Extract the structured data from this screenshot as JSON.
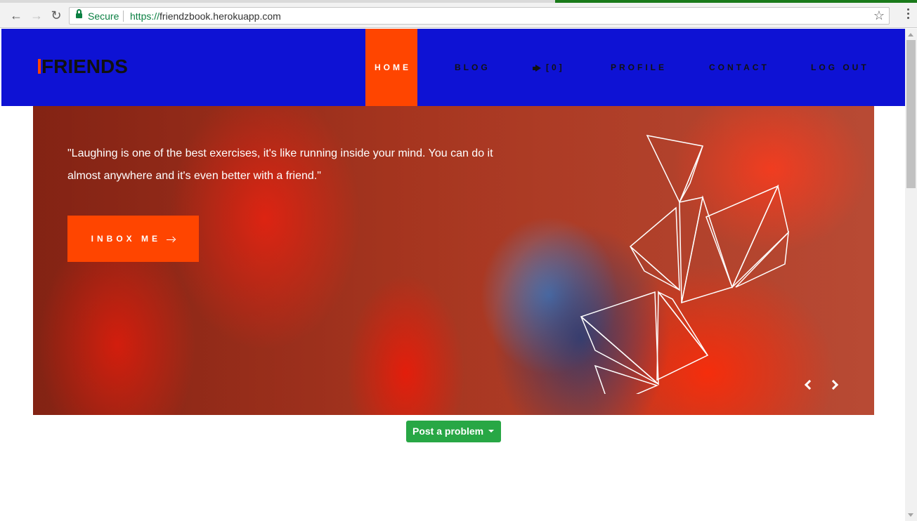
{
  "browser": {
    "security_label": "Secure",
    "url_scheme": "https://",
    "url_rest": "friendzbook.herokuapp.com"
  },
  "header": {
    "logo": "FRIENDS",
    "accent_color": "#ff4500",
    "background_color": "#0e12d4",
    "nav": {
      "home": "HOME",
      "blog": "BLOG",
      "notifications": "[0]",
      "profile": "PROFILE",
      "contact": "CONTACT",
      "logout": "LOG OUT"
    },
    "notifications_icon": "megaphone-icon"
  },
  "hero": {
    "quote": "\"Laughing is one of the best exercises, it's like running inside your mind. You can do it almost anywhere and it's even better with a friend.\"",
    "cta_label": "INBOX ME",
    "prev_icon": "chevron-left-icon",
    "next_icon": "chevron-right-icon"
  },
  "post_button": {
    "label": "Post a problem",
    "color": "#28a745"
  }
}
